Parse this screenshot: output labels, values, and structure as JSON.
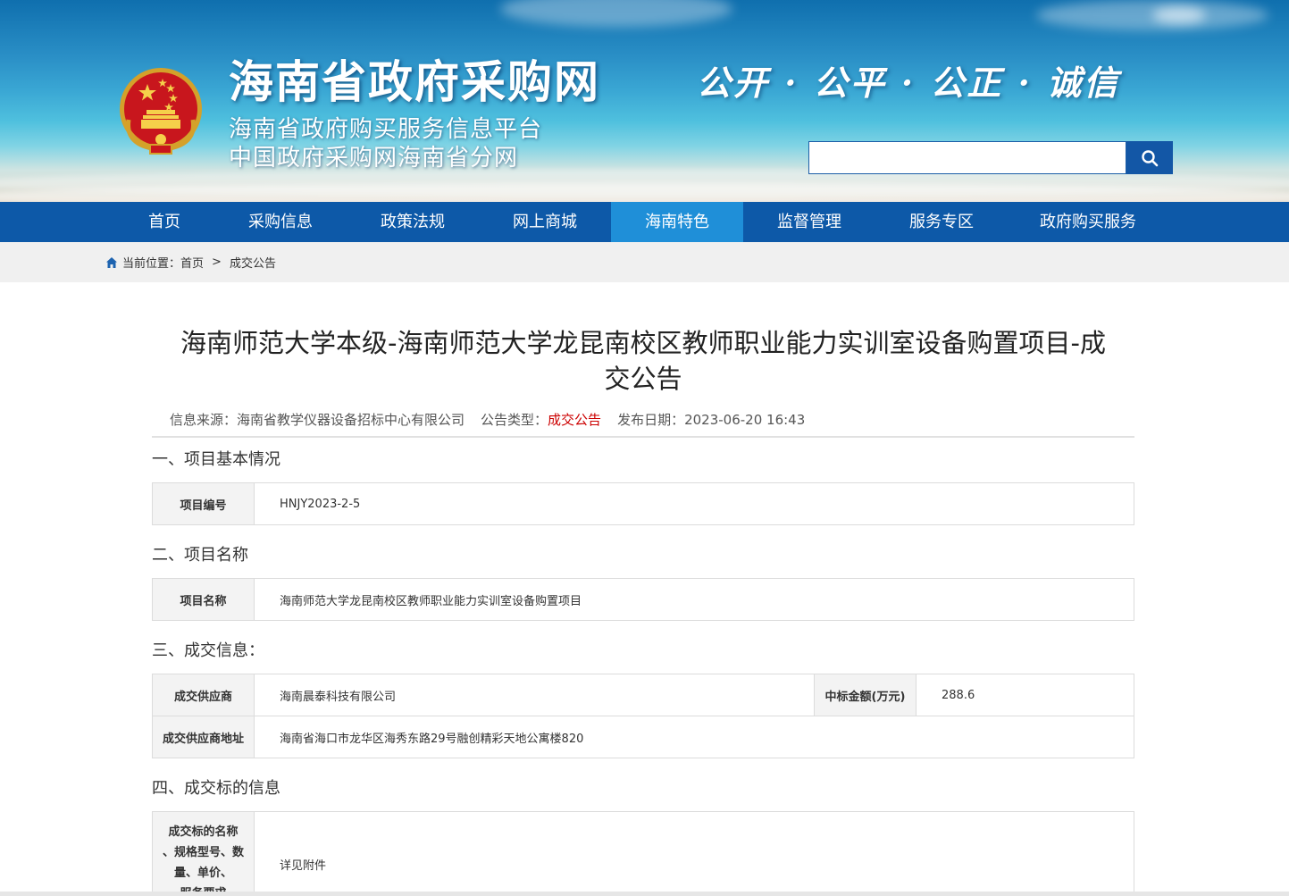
{
  "header": {
    "site_title": "海南省政府采购网",
    "subtitle_1": "海南省政府购买服务信息平台",
    "subtitle_2": "中国政府采购网海南省分网",
    "slogan": "公开 · 公平 · 公正 · 诚信",
    "search": {
      "value": "",
      "placeholder": ""
    }
  },
  "nav": {
    "items": [
      "首页",
      "采购信息",
      "政策法规",
      "网上商城",
      "海南特色",
      "监督管理",
      "服务专区",
      "政府购买服务"
    ],
    "active": "海南特色"
  },
  "breadcrumb": {
    "prefix": "当前位置：",
    "home": "首页",
    "separator": ">",
    "current": "成交公告"
  },
  "article": {
    "title_line1": "海南师范大学本级-海南师范大学龙昆南校区教师职业能力实训室设备购置项目-成",
    "title_line2": "交公告",
    "meta": {
      "source_label": "信息来源：",
      "source": "海南省教学仪器设备招标中心有限公司",
      "type_label": "公告类型：",
      "type": "成交公告",
      "date_label": "发布日期：",
      "date": "2023-06-20 16:43"
    },
    "sections": {
      "s1": {
        "heading": "一、项目基本情况",
        "label": "项目编号",
        "value": "HNJY2023-2-5"
      },
      "s2": {
        "heading": "二、项目名称",
        "label": "项目名称",
        "value": "海南师范大学龙昆南校区教师职业能力实训室设备购置项目"
      },
      "s3": {
        "heading": "三、成交信息：",
        "supplier_label": "成交供应商",
        "supplier": "海南晨泰科技有限公司",
        "amount_label": "中标金额(万元)",
        "amount": "288.6",
        "address_label": "成交供应商地址",
        "address": "海南省海口市龙华区海秀东路29号融创精彩天地公寓楼820"
      },
      "s4": {
        "heading": "四、成交标的信息",
        "label_line1": "成交标的名称",
        "label_line2": "、规格型号、数",
        "label_line3": "量、单价、",
        "label_line4": "服务要求",
        "value": "详见附件"
      }
    }
  },
  "colors": {
    "nav_bg": "#0d59a8",
    "nav_active": "#1f8fd8",
    "type_red": "#cc0000"
  }
}
